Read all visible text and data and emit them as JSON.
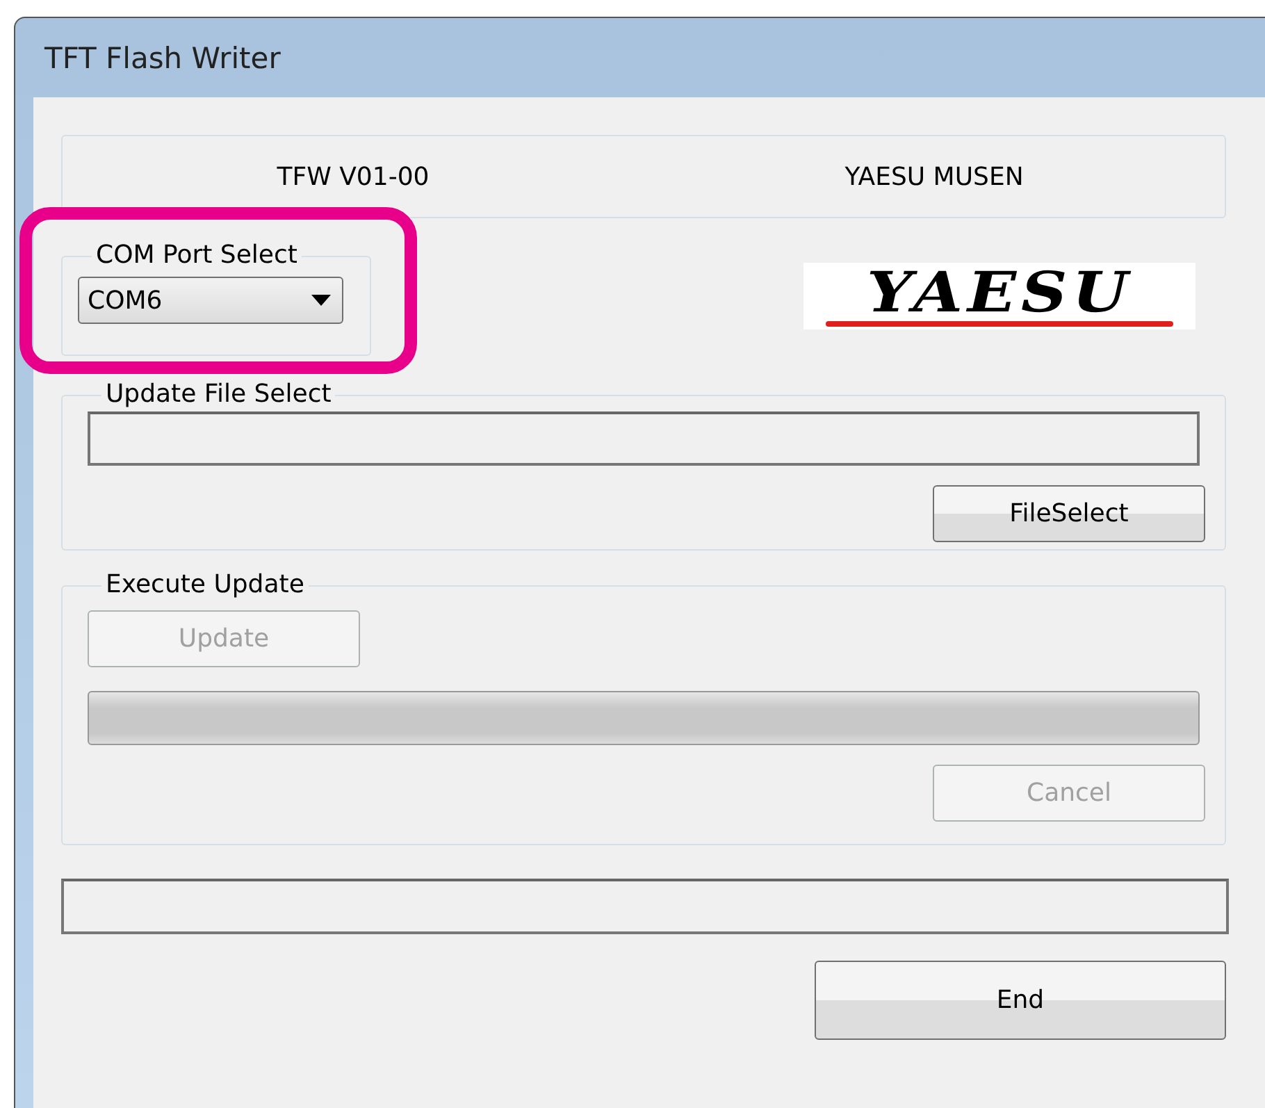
{
  "window": {
    "title": "TFT Flash Writer"
  },
  "header": {
    "version": "TFW V01-00",
    "company": "YAESU MUSEN"
  },
  "com_port": {
    "label": "COM Port Select",
    "value": "COM6",
    "highlighted": true
  },
  "logo": {
    "text": "YAESU"
  },
  "update_file": {
    "label": "Update File Select",
    "button": {
      "label": "FileSelect",
      "disabled": false
    }
  },
  "execute": {
    "label": "Execute Update",
    "update_button": {
      "label": "Update",
      "disabled": true
    },
    "progress": {
      "level": 0
    },
    "cancel_button": {
      "label": "Cancel",
      "disabled": true
    }
  },
  "end_button": {
    "label": "End",
    "disabled": false
  }
}
